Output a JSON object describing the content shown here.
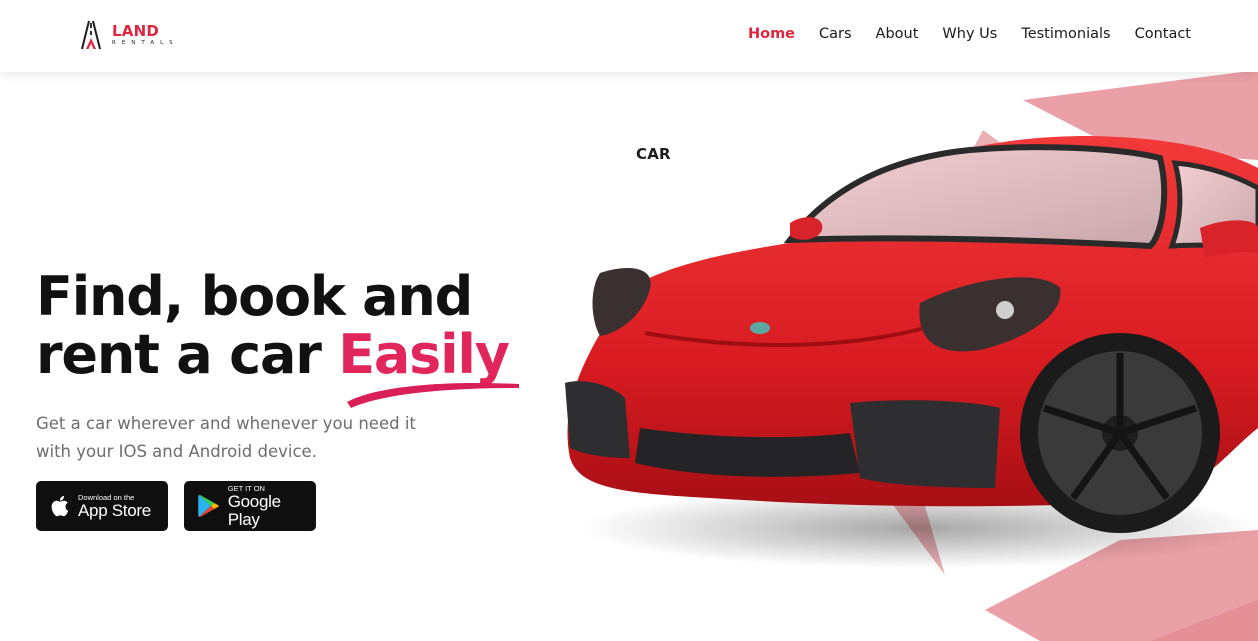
{
  "brand": {
    "name_part1": "CAR",
    "name_part2": "LAND",
    "tagline": "RENTALS"
  },
  "nav": {
    "items": [
      {
        "label": "Home",
        "active": true
      },
      {
        "label": "Cars",
        "active": false
      },
      {
        "label": "About",
        "active": false
      },
      {
        "label": "Why Us",
        "active": false
      },
      {
        "label": "Testimonials",
        "active": false
      },
      {
        "label": "Contact",
        "active": false
      }
    ]
  },
  "hero": {
    "headline_line1": "Find, book and",
    "headline_line2_prefix": "rent a car ",
    "headline_highlight": "Easily",
    "subtext": "Get a car wherever and whenever you need it with your IOS and Android device."
  },
  "apps": {
    "apple": {
      "small": "Download on the",
      "big": "App Store"
    },
    "google": {
      "small": "GET IT ON",
      "big": "Google Play"
    }
  },
  "colors": {
    "accent": "#e0263e",
    "highlight": "#e0265a",
    "shape": "#e9a0a6",
    "button": "#0f0f10"
  },
  "icons": {
    "apple": "apple-logo-icon",
    "google": "google-play-icon",
    "logo": "road-logo-icon"
  }
}
